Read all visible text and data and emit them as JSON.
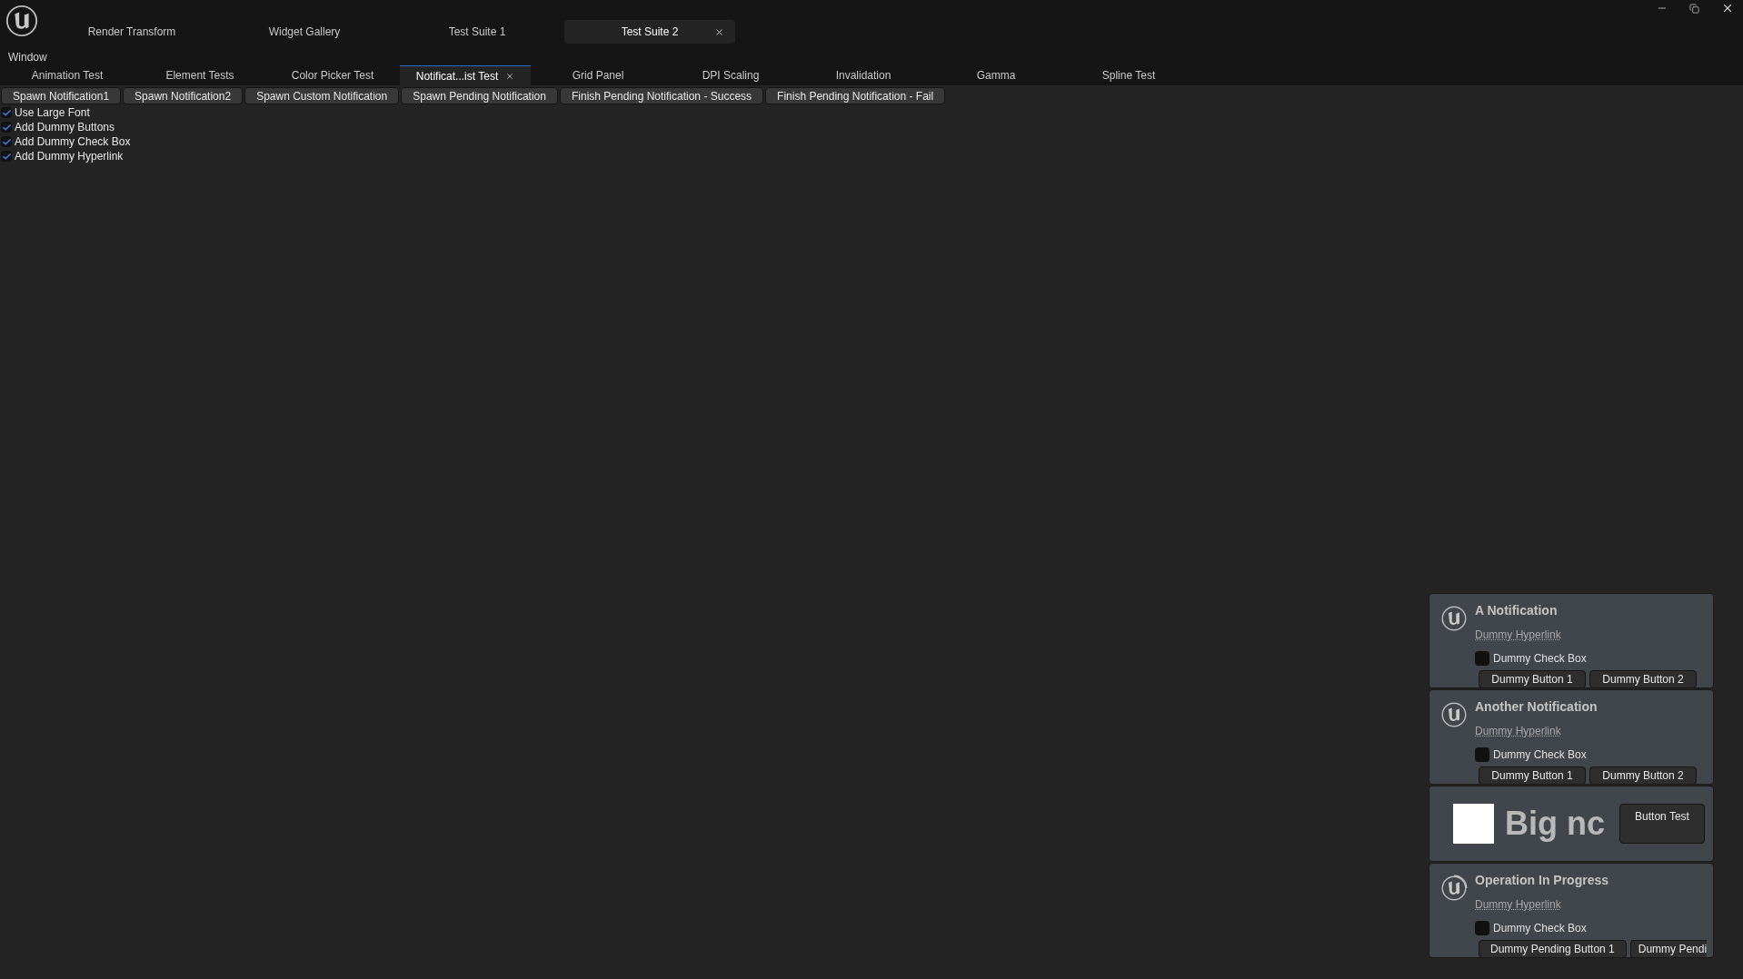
{
  "top_tabs": [
    {
      "label": "Render Transform",
      "selected": false
    },
    {
      "label": "Widget Gallery",
      "selected": false
    },
    {
      "label": "Test Suite 1",
      "selected": false
    },
    {
      "label": "Test Suite 2",
      "selected": true
    }
  ],
  "menu": [
    "Window"
  ],
  "test_tabs": [
    {
      "label": "Animation Test",
      "selected": false
    },
    {
      "label": "Element Tests",
      "selected": false
    },
    {
      "label": "Color Picker Test",
      "selected": false
    },
    {
      "label": "Notificat...ist Test",
      "selected": true
    },
    {
      "label": "Grid Panel",
      "selected": false
    },
    {
      "label": "DPI Scaling",
      "selected": false
    },
    {
      "label": "Invalidation",
      "selected": false
    },
    {
      "label": "Gamma",
      "selected": false
    },
    {
      "label": "Spline Test",
      "selected": false
    }
  ],
  "action_buttons": [
    "Spawn Notification1",
    "Spawn Notification2",
    "Spawn Custom Notification",
    "Spawn Pending Notification",
    "Finish Pending Notification - Success",
    "Finish Pending Notification - Fail"
  ],
  "options": [
    {
      "label": "Use Large Font",
      "checked": true
    },
    {
      "label": "Add Dummy Buttons",
      "checked": true
    },
    {
      "label": "Add Dummy Check Box",
      "checked": true
    },
    {
      "label": "Add Dummy Hyperlink",
      "checked": true
    }
  ],
  "notifications": [
    {
      "kind": "standard",
      "title": "A Notification",
      "hyperlink": "Dummy Hyperlink",
      "checkbox": {
        "label": "Dummy Check Box",
        "checked": false
      },
      "buttons": [
        "Dummy Button 1",
        "Dummy Button 2"
      ]
    },
    {
      "kind": "standard",
      "title": "Another Notification",
      "hyperlink": "Dummy Hyperlink",
      "checkbox": {
        "label": "Dummy Check Box",
        "checked": false
      },
      "buttons": [
        "Dummy Button 1",
        "Dummy Button 2"
      ]
    },
    {
      "kind": "big",
      "text": "Big nc",
      "button": "Button Test"
    },
    {
      "kind": "pending",
      "title": "Operation In Progress",
      "hyperlink": "Dummy Hyperlink",
      "checkbox": {
        "label": "Dummy Check Box",
        "checked": false
      },
      "buttons": [
        "Dummy Pending Button 1",
        "Dummy Pendi"
      ]
    }
  ]
}
